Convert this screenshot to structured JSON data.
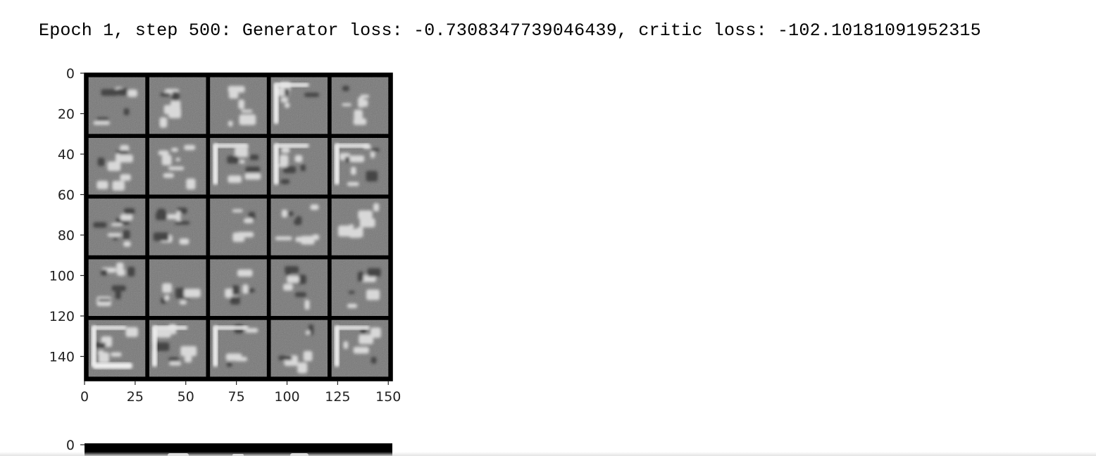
{
  "output": {
    "log_line": "Epoch 1, step 500: Generator loss: -0.7308347739046439, critic loss: -102.10181091952315"
  },
  "figure": {
    "image_grid": {
      "rows": 5,
      "cols": 5
    },
    "y_ticks": [
      "0",
      "20",
      "40",
      "60",
      "80",
      "100",
      "120",
      "140"
    ],
    "x_ticks": [
      "0",
      "25",
      "50",
      "75",
      "100",
      "125",
      "150"
    ]
  },
  "figure2": {
    "y_ticks": [
      "0"
    ]
  }
}
